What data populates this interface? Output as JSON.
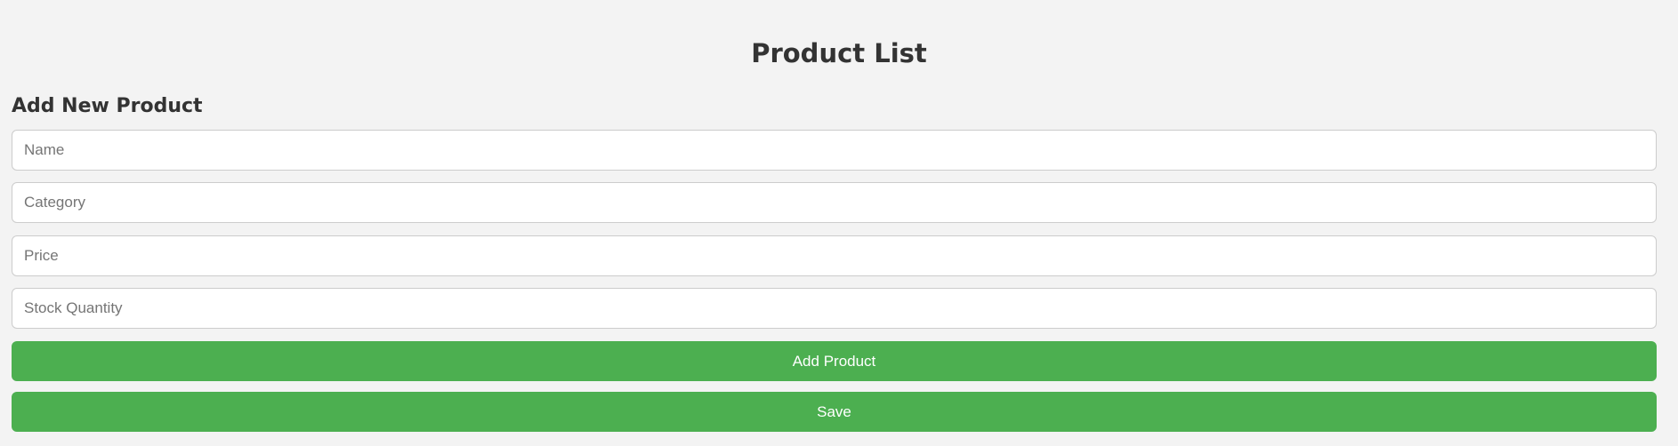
{
  "page": {
    "title": "Product List"
  },
  "form": {
    "heading": "Add New Product",
    "fields": {
      "name": {
        "placeholder": "Name",
        "value": ""
      },
      "category": {
        "placeholder": "Category",
        "value": ""
      },
      "price": {
        "placeholder": "Price",
        "value": ""
      },
      "stock_quantity": {
        "placeholder": "Stock Quantity",
        "value": ""
      }
    },
    "add_button_label": "Add Product",
    "save_button_label": "Save"
  },
  "colors": {
    "background": "#f3f3f3",
    "heading_text": "#333333",
    "button": "#4caf50",
    "button_text": "#ffffff",
    "field_border": "#cccccc",
    "placeholder_text": "#757575"
  }
}
